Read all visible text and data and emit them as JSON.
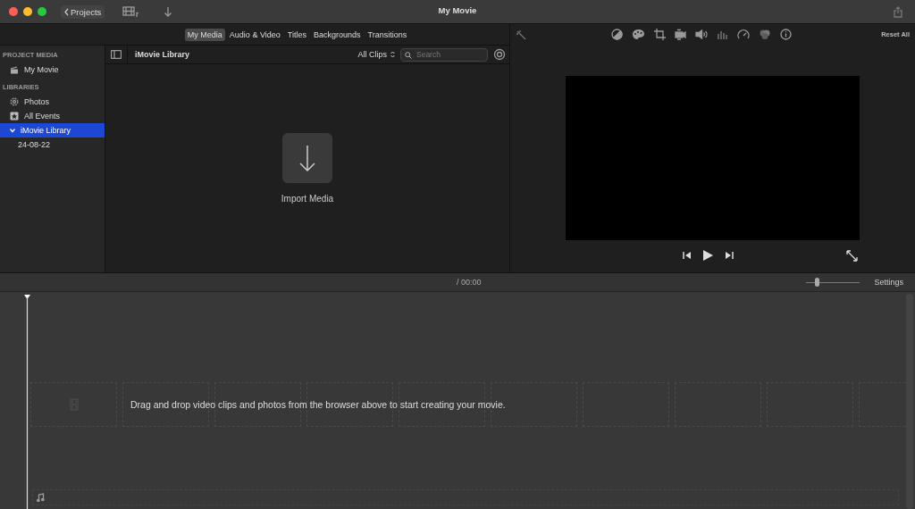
{
  "window": {
    "title": "My Movie"
  },
  "toolbar": {
    "back_label": "Projects"
  },
  "media_tabs": [
    {
      "label": "My Media",
      "selected": true
    },
    {
      "label": "Audio & Video",
      "selected": false
    },
    {
      "label": "Titles",
      "selected": false
    },
    {
      "label": "Backgrounds",
      "selected": false
    },
    {
      "label": "Transitions",
      "selected": false
    }
  ],
  "sidebar": {
    "sections": [
      {
        "title": "PROJECT MEDIA",
        "items": [
          {
            "label": "My Movie",
            "kind": "project",
            "selected": false
          }
        ]
      },
      {
        "title": "LIBRARIES",
        "items": [
          {
            "label": "Photos",
            "kind": "photos",
            "selected": false
          },
          {
            "label": "All Events",
            "kind": "events",
            "selected": false
          },
          {
            "label": "iMovie Library",
            "selected": true,
            "expanded": true,
            "children": [
              {
                "label": "24-08-22",
                "selected": false
              }
            ]
          }
        ]
      }
    ]
  },
  "browser": {
    "title": "iMovie Library",
    "filter": "All Clips",
    "search": {
      "placeholder": "Search"
    },
    "import_label": "Import Media"
  },
  "viewer": {
    "reset_label": "Reset All"
  },
  "timeline": {
    "timecode": "/ 00:00",
    "settings_label": "Settings",
    "zoom": {
      "level": 0.2
    },
    "hint": "Drag and drop video clips and photos from the browser above to start creating your movie."
  }
}
